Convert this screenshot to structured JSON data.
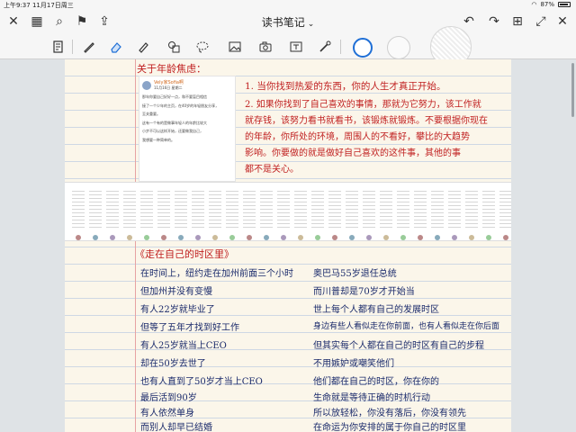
{
  "status": {
    "time": "上午9:37",
    "date": "11月17日周三",
    "battery": "87%"
  },
  "app": {
    "title": "读书笔记",
    "title_chevron": "⌄"
  },
  "top_icons": {
    "close": "✕",
    "grid": "▦",
    "search": "⌕",
    "bookmark": "⚑",
    "share": "⇪",
    "undo": "↶",
    "redo": "↷",
    "add_page": "⊞",
    "fullscreen": "⤢",
    "more": "✕"
  },
  "tools": [
    "document-scan-icon",
    "pen-icon",
    "eraser-icon",
    "highlighter-icon",
    "shapes-icon",
    "lasso-icon",
    "image-icon",
    "camera-icon",
    "text-icon",
    "laser-icon"
  ],
  "colors": {
    "accent": "#1f6fd6",
    "red_ink": "#c01f1f",
    "navy_ink": "#1a2a6b",
    "paper": "#fbf6ea"
  },
  "note": {
    "section1_title": "关于年龄焦虑：",
    "post": {
      "name": "Vely家Sofia啊",
      "meta": "11月16日 星期二",
      "lines": [
        "那年你要自己好好一点，和不要盲目相信",
        "接了一个少年的主页，在40岁的年轻朋友分享，",
        "至关重要。",
        "这有一个有的是做事年轻人的年龄比较大",
        "小步不可以这样开始，还要做我自己，",
        "我想要一种简单的。"
      ]
    },
    "red_lines": [
      "1. 当你找到热爱的东西，你的人生才真正开始。",
      "2. 如果你找到了自己喜欢的事情，那就为它努力，该工作就",
      "就存钱，该努力看书就看书，该锻炼就锻炼。不要根据你现在",
      "的年龄，你所处的环境，周围人的不看好，攀比的大趋势",
      "影响。你要做的就是做好自己喜欢的这件事，其他的事",
      "都不是关心。"
    ],
    "section2_title": "《走在自己的时区里》",
    "left_lines": [
      "在时间上，纽约走在加州前面三个小时",
      "但加州并没有变慢",
      "有人22岁就毕业了",
      "但等了五年才找到好工作",
      "有人25岁就当上CEO",
      "却在50岁去世了",
      "也有人直到了50岁才当上CEO",
      "最后活到90岁",
      "有人依然单身",
      "而别人却早已结婚"
    ],
    "right_lines": [
      "奥巴马55岁退任总统",
      "而川普却是70岁才开始当",
      "世上每个人都有自己的发展时区",
      "身边有些人看似走在你前面，也有人看似走在你后面",
      "但其实每个人都在自己的时区有自己的步程",
      "不用嫉妒或嘲笑他们",
      "他们都在自己的时区，你在你的",
      "生命就是等待正确的时机行动",
      "所以放轻松，你没有落后，你没有领先",
      "在命运为你安排的属于你自己的时区里"
    ]
  }
}
